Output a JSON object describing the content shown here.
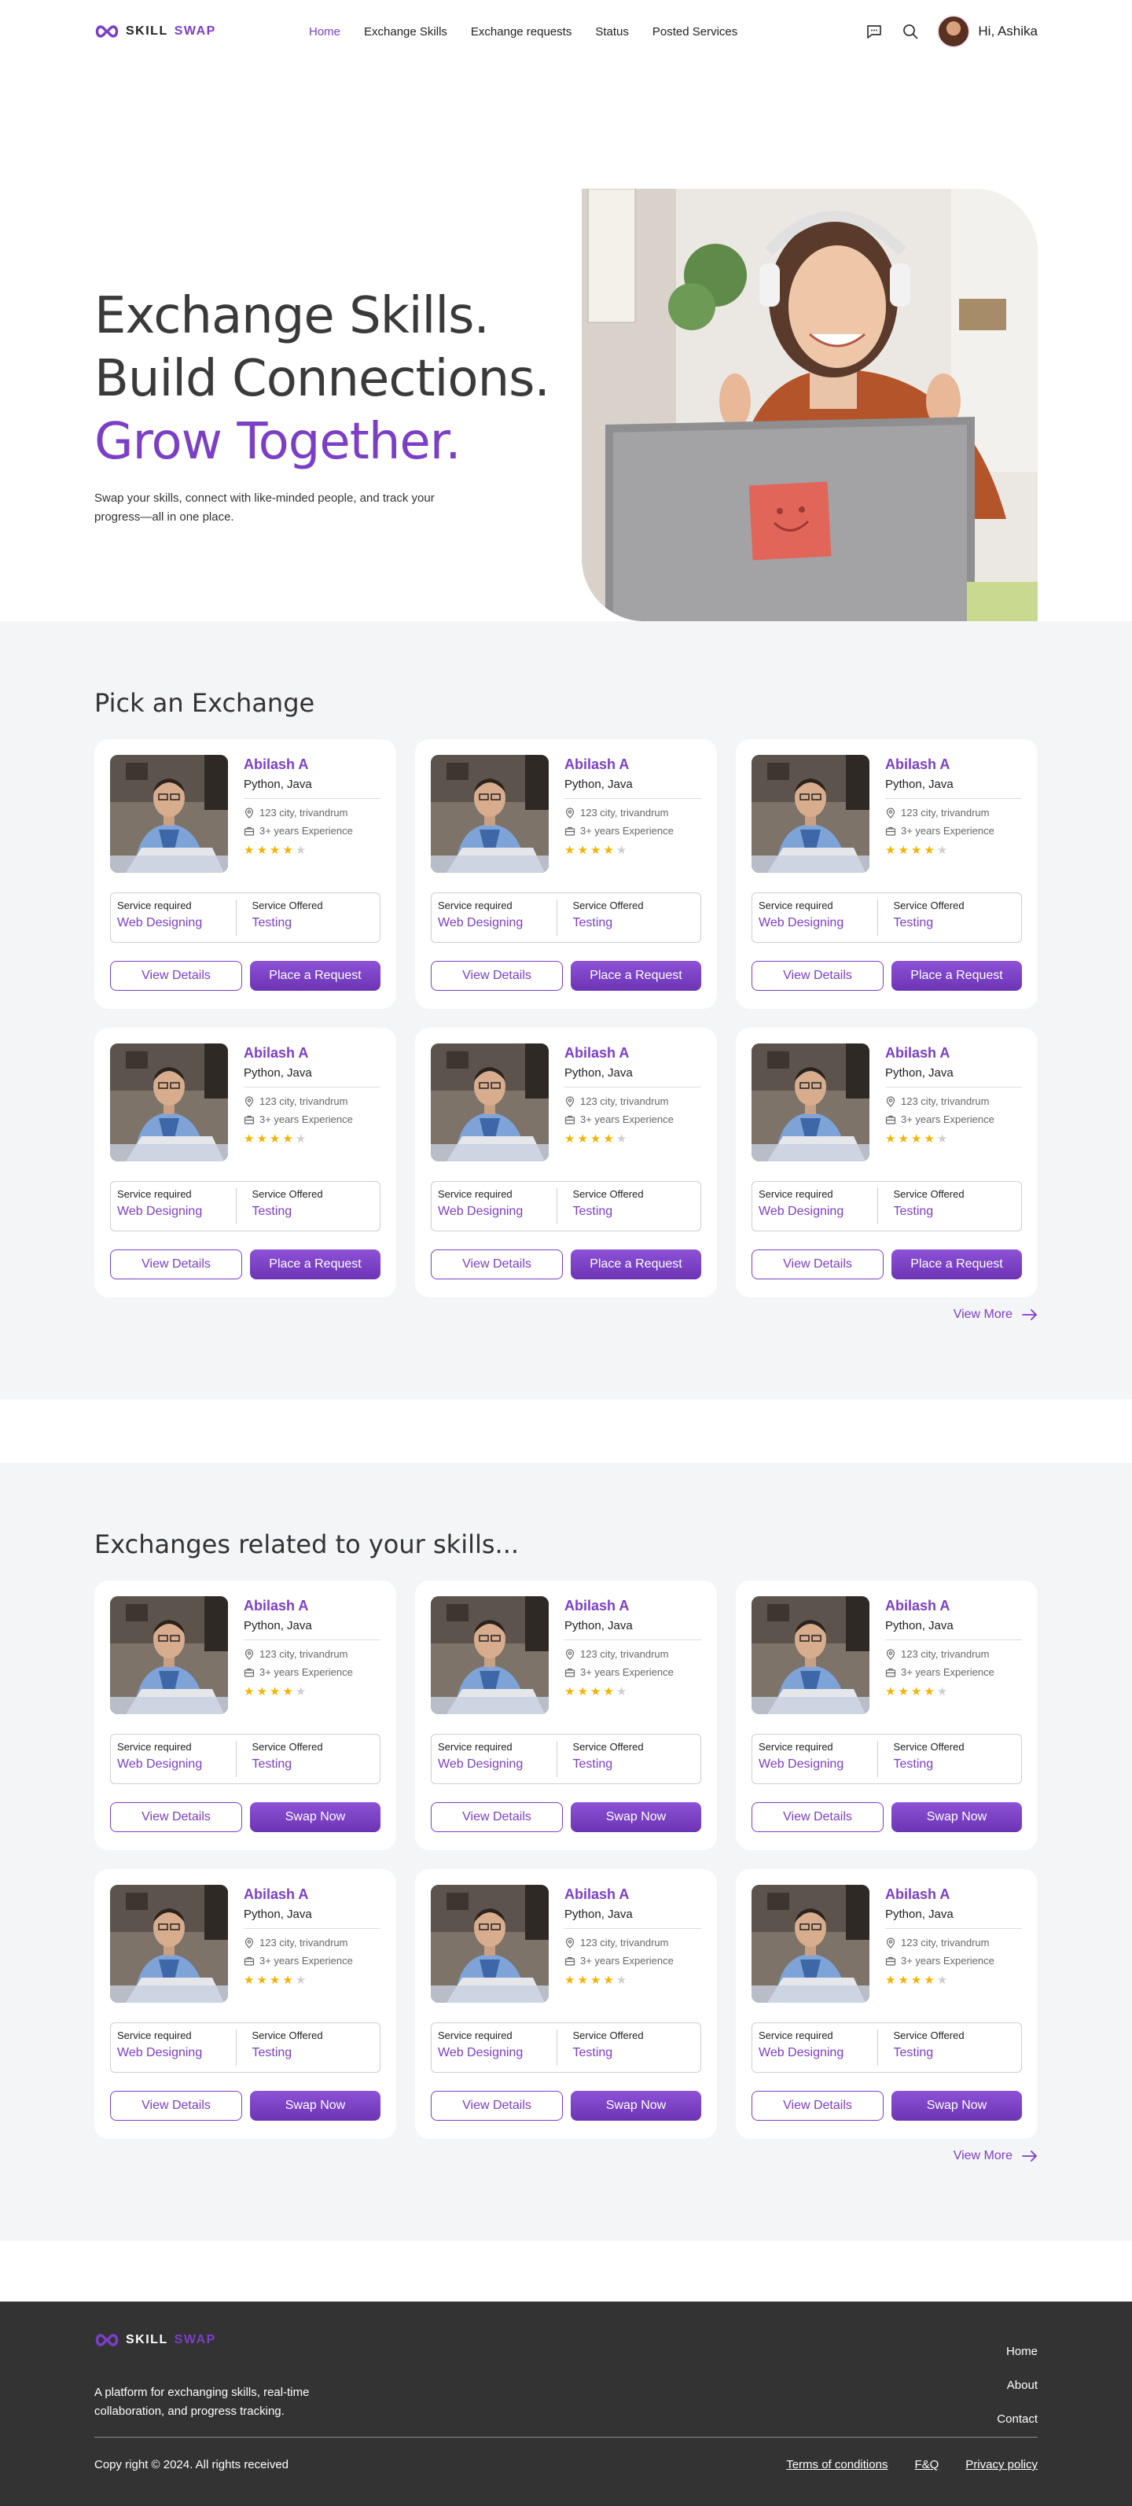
{
  "brand": {
    "part1": "SKILL",
    "part2": "SWAP"
  },
  "nav": {
    "links": [
      "Home",
      "Exchange Skills",
      "Exchange requests",
      "Status",
      "Posted Services"
    ],
    "greeting": "Hi, Ashika"
  },
  "hero": {
    "line1": "Exchange Skills.",
    "line2": "Build Connections.",
    "line3": "Grow Together.",
    "subtitle": "Swap your skills, connect with like-minded people, and track your progress—all in one place."
  },
  "section1": {
    "title": "Pick an Exchange",
    "primary_button": "Place a Request",
    "view_more": "View More"
  },
  "section2": {
    "title": "Exchanges related to your skills...",
    "primary_button": "Swap Now",
    "view_more": "View More"
  },
  "card": {
    "name": "Abilash A",
    "skills": "Python, Java",
    "location": "123 city, trivandrum",
    "experience": "3+ years Experience",
    "rating": 4,
    "rating_max": 5,
    "service_required_label": "Service required",
    "service_required": "Web Designing",
    "service_offered_label": "Service Offered",
    "service_offered": "Testing",
    "details_button": "View Details"
  },
  "footer": {
    "description": "A platform for exchanging skills, real-time collaboration, and progress tracking.",
    "links": [
      "Home",
      "About",
      "Contact"
    ],
    "copyright": "Copy right © 2024. All rights received",
    "legal": [
      "Terms of conditions",
      "F&Q",
      "Privacy policy"
    ]
  },
  "colors": {
    "accent": "#7b3fc6",
    "star": "#f5b301",
    "section_bg": "#f4f5f7",
    "footer_bg": "#333334"
  }
}
